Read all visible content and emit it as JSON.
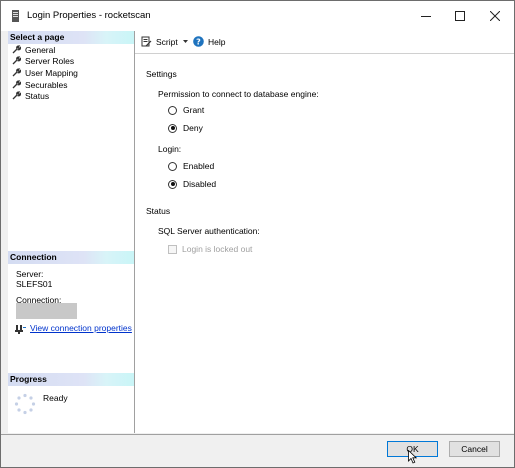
{
  "window": {
    "title": "Login Properties - rocketscan"
  },
  "left_pane": {
    "select_page_header": "Select a page",
    "pages": [
      {
        "label": "General"
      },
      {
        "label": "Server Roles"
      },
      {
        "label": "User Mapping"
      },
      {
        "label": "Securables"
      },
      {
        "label": "Status"
      }
    ],
    "connection": {
      "header": "Connection",
      "server_label": "Server:",
      "server_value": "SLEFS01",
      "connection_label": "Connection:",
      "view_link": "View connection properties"
    },
    "progress": {
      "header": "Progress",
      "status": "Ready"
    }
  },
  "toolbar": {
    "script_label": "Script",
    "help_label": "Help"
  },
  "content": {
    "settings_header": "Settings",
    "permission_label": "Permission to connect to database engine:",
    "permission_options": [
      {
        "label": "Grant",
        "checked": false
      },
      {
        "label": "Deny",
        "checked": true
      }
    ],
    "login_label": "Login:",
    "login_options": [
      {
        "label": "Enabled",
        "checked": false
      },
      {
        "label": "Disabled",
        "checked": true
      }
    ],
    "status_header": "Status",
    "sql_auth_label": "SQL Server authentication:",
    "locked_out_label": "Login is locked out"
  },
  "buttons": {
    "ok": "OK",
    "cancel": "Cancel"
  }
}
